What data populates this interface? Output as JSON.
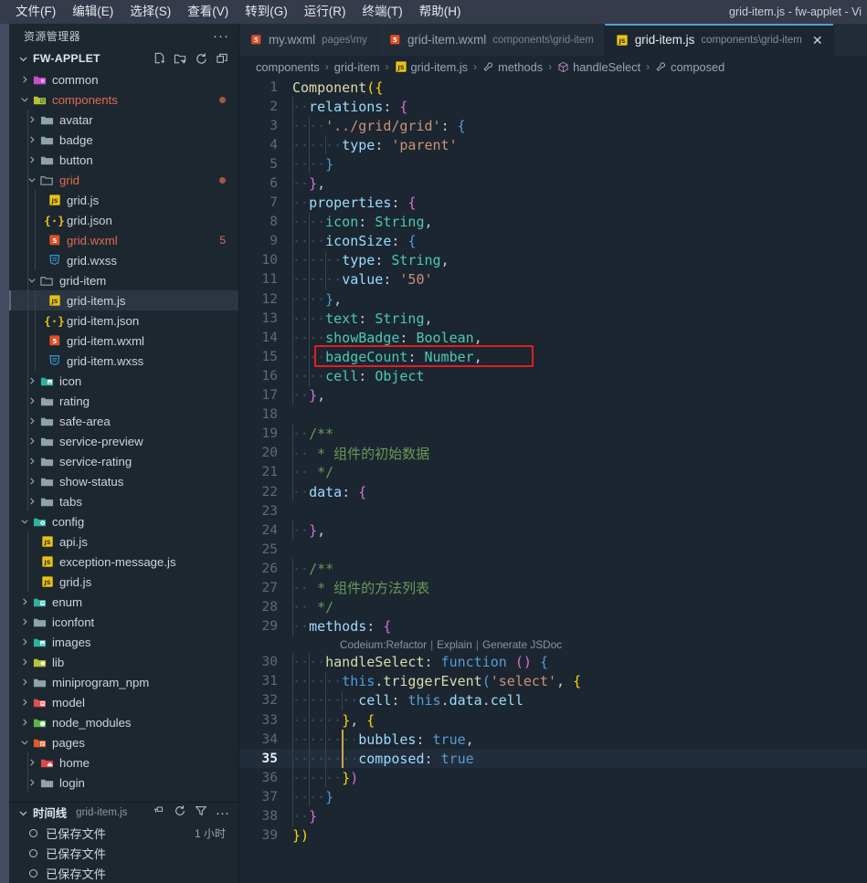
{
  "window": {
    "title": "grid-item.js - fw-applet - Vi",
    "menu": [
      "文件(F)",
      "编辑(E)",
      "选择(S)",
      "查看(V)",
      "转到(G)",
      "运行(R)",
      "终端(T)",
      "帮助(H)"
    ]
  },
  "sidebar": {
    "header_title": "资源管理器",
    "header_more": "···",
    "root": {
      "label": "FW-APPLET",
      "actions": [
        "new-file-icon",
        "new-folder-icon",
        "refresh-icon",
        "collapse-all-icon"
      ]
    },
    "tree": [
      {
        "label": "common",
        "depth": 1,
        "type": "folder",
        "icon": "folder-purple",
        "expanded": false
      },
      {
        "label": "components",
        "depth": 1,
        "type": "folder",
        "icon": "folder-lime",
        "expanded": true,
        "modified": true,
        "dot": true
      },
      {
        "label": "avatar",
        "depth": 2,
        "type": "folder",
        "icon": "folder-gray",
        "expanded": false
      },
      {
        "label": "badge",
        "depth": 2,
        "type": "folder",
        "icon": "folder-gray",
        "expanded": false
      },
      {
        "label": "button",
        "depth": 2,
        "type": "folder",
        "icon": "folder-gray",
        "expanded": false
      },
      {
        "label": "grid",
        "depth": 2,
        "type": "folder",
        "icon": "folder-open-gray",
        "expanded": true,
        "modified": true,
        "dot": true
      },
      {
        "label": "grid.js",
        "depth": 3,
        "type": "file",
        "icon": "js-icon"
      },
      {
        "label": "grid.json",
        "depth": 3,
        "type": "file",
        "icon": "json-icon"
      },
      {
        "label": "grid.wxml",
        "depth": 3,
        "type": "file",
        "icon": "html-icon",
        "modified": true,
        "badge": "5"
      },
      {
        "label": "grid.wxss",
        "depth": 3,
        "type": "file",
        "icon": "css-icon"
      },
      {
        "label": "grid-item",
        "depth": 2,
        "type": "folder",
        "icon": "folder-open-gray",
        "expanded": true
      },
      {
        "label": "grid-item.js",
        "depth": 3,
        "type": "file",
        "icon": "js-icon",
        "selected": true
      },
      {
        "label": "grid-item.json",
        "depth": 3,
        "type": "file",
        "icon": "json-icon"
      },
      {
        "label": "grid-item.wxml",
        "depth": 3,
        "type": "file",
        "icon": "html-icon"
      },
      {
        "label": "grid-item.wxss",
        "depth": 3,
        "type": "file",
        "icon": "css-icon"
      },
      {
        "label": "icon",
        "depth": 2,
        "type": "folder",
        "icon": "folder-teal-img",
        "expanded": false
      },
      {
        "label": "rating",
        "depth": 2,
        "type": "folder",
        "icon": "folder-gray",
        "expanded": false
      },
      {
        "label": "safe-area",
        "depth": 2,
        "type": "folder",
        "icon": "folder-gray",
        "expanded": false
      },
      {
        "label": "service-preview",
        "depth": 2,
        "type": "folder",
        "icon": "folder-gray",
        "expanded": false
      },
      {
        "label": "service-rating",
        "depth": 2,
        "type": "folder",
        "icon": "folder-gray",
        "expanded": false
      },
      {
        "label": "show-status",
        "depth": 2,
        "type": "folder",
        "icon": "folder-gray",
        "expanded": false
      },
      {
        "label": "tabs",
        "depth": 2,
        "type": "folder",
        "icon": "folder-gray",
        "expanded": false
      },
      {
        "label": "config",
        "depth": 1,
        "type": "folder",
        "icon": "folder-teal-gear",
        "expanded": true
      },
      {
        "label": "api.js",
        "depth": 2,
        "type": "file",
        "icon": "js-icon"
      },
      {
        "label": "exception-message.js",
        "depth": 2,
        "type": "file",
        "icon": "js-icon"
      },
      {
        "label": "grid.js",
        "depth": 2,
        "type": "file",
        "icon": "js-icon"
      },
      {
        "label": "enum",
        "depth": 1,
        "type": "folder",
        "icon": "folder-teal-list",
        "expanded": false
      },
      {
        "label": "iconfont",
        "depth": 1,
        "type": "folder",
        "icon": "folder-gray",
        "expanded": false
      },
      {
        "label": "images",
        "depth": 1,
        "type": "folder",
        "icon": "folder-teal-img",
        "expanded": false
      },
      {
        "label": "lib",
        "depth": 1,
        "type": "folder",
        "icon": "folder-lime-lib",
        "expanded": false
      },
      {
        "label": "miniprogram_npm",
        "depth": 1,
        "type": "folder",
        "icon": "folder-gray",
        "expanded": false
      },
      {
        "label": "model",
        "depth": 1,
        "type": "folder",
        "icon": "folder-red-list",
        "expanded": false
      },
      {
        "label": "node_modules",
        "depth": 1,
        "type": "folder",
        "icon": "folder-green-node",
        "expanded": false
      },
      {
        "label": "pages",
        "depth": 1,
        "type": "folder",
        "icon": "folder-orange-pages",
        "expanded": true
      },
      {
        "label": "home",
        "depth": 2,
        "type": "folder",
        "icon": "folder-red-home",
        "expanded": false
      },
      {
        "label": "login",
        "depth": 2,
        "type": "folder",
        "icon": "folder-gray",
        "expanded": false
      }
    ],
    "timeline": {
      "title": "时间线",
      "subtitle": "grid-item.js",
      "actions": [
        "pin-icon",
        "refresh-icon",
        "filter-icon",
        "more-icon"
      ],
      "entries": [
        {
          "label": "已保存文件",
          "when": "1 小时"
        },
        {
          "label": "已保存文件",
          "when": ""
        },
        {
          "label": "已保存文件",
          "when": ""
        }
      ]
    }
  },
  "tabs": [
    {
      "name": "my.wxml",
      "path": "pages\\my",
      "icon": "wxml-icon",
      "active": false,
      "closable": false
    },
    {
      "name": "grid-item.wxml",
      "path": "components\\grid-item",
      "icon": "wxml-icon",
      "active": false,
      "closable": false
    },
    {
      "name": "grid-item.js",
      "path": "components\\grid-item",
      "icon": "js-icon",
      "active": true,
      "closable": true,
      "close": "✕"
    }
  ],
  "breadcrumb": [
    {
      "label": "components",
      "icon": ""
    },
    {
      "label": "grid-item",
      "icon": ""
    },
    {
      "label": "grid-item.js",
      "icon": "js-icon"
    },
    {
      "label": "methods",
      "icon": "wrench-icon"
    },
    {
      "label": "handleSelect",
      "icon": "cube-icon"
    },
    {
      "label": "composed",
      "icon": "wrench-icon"
    }
  ],
  "editor": {
    "current_line": 35,
    "codelens": {
      "prefix": "Codeium:",
      "items": [
        "Refactor",
        "Explain",
        "Generate JSDoc"
      ],
      "after_line": 29
    },
    "annotation": {
      "line": 15,
      "color": "#e02020"
    },
    "lines": [
      {
        "n": 1,
        "tokens": [
          {
            "t": "Component",
            "c": "t-fn"
          },
          {
            "t": "(",
            "c": "t-b1"
          },
          {
            "t": "{",
            "c": "t-b1"
          }
        ]
      },
      {
        "n": 2,
        "indent": 1,
        "tokens": [
          {
            "t": "relations",
            "c": "t-prop"
          },
          {
            "t": ": ",
            "c": "t-plain"
          },
          {
            "t": "{",
            "c": "t-b2"
          }
        ]
      },
      {
        "n": 3,
        "indent": 2,
        "tokens": [
          {
            "t": "'../grid/grid'",
            "c": "t-str"
          },
          {
            "t": ": ",
            "c": "t-plain"
          },
          {
            "t": "{",
            "c": "t-b3"
          }
        ]
      },
      {
        "n": 4,
        "indent": 3,
        "tokens": [
          {
            "t": "type",
            "c": "t-prop"
          },
          {
            "t": ": ",
            "c": "t-plain"
          },
          {
            "t": "'parent'",
            "c": "t-str"
          }
        ]
      },
      {
        "n": 5,
        "indent": 2,
        "tokens": [
          {
            "t": "}",
            "c": "t-b3"
          }
        ]
      },
      {
        "n": 6,
        "indent": 1,
        "tokens": [
          {
            "t": "}",
            "c": "t-b2"
          },
          {
            "t": ",",
            "c": "t-plain"
          }
        ]
      },
      {
        "n": 7,
        "indent": 1,
        "tokens": [
          {
            "t": "properties",
            "c": "t-prop"
          },
          {
            "t": ": ",
            "c": "t-plain"
          },
          {
            "t": "{",
            "c": "t-b2"
          }
        ]
      },
      {
        "n": 8,
        "indent": 2,
        "tokens": [
          {
            "t": "icon",
            "c": "t-type"
          },
          {
            "t": ": ",
            "c": "t-plain"
          },
          {
            "t": "String",
            "c": "t-type"
          },
          {
            "t": ",",
            "c": "t-plain"
          }
        ]
      },
      {
        "n": 9,
        "indent": 2,
        "tokens": [
          {
            "t": "iconSize",
            "c": "t-prop"
          },
          {
            "t": ": ",
            "c": "t-plain"
          },
          {
            "t": "{",
            "c": "t-b3"
          }
        ]
      },
      {
        "n": 10,
        "indent": 3,
        "tokens": [
          {
            "t": "type",
            "c": "t-prop"
          },
          {
            "t": ": ",
            "c": "t-plain"
          },
          {
            "t": "String",
            "c": "t-type"
          },
          {
            "t": ",",
            "c": "t-plain"
          }
        ]
      },
      {
        "n": 11,
        "indent": 3,
        "tokens": [
          {
            "t": "value",
            "c": "t-prop"
          },
          {
            "t": ": ",
            "c": "t-plain"
          },
          {
            "t": "'50'",
            "c": "t-str"
          }
        ]
      },
      {
        "n": 12,
        "indent": 2,
        "tokens": [
          {
            "t": "}",
            "c": "t-b3"
          },
          {
            "t": ",",
            "c": "t-plain"
          }
        ]
      },
      {
        "n": 13,
        "indent": 2,
        "tokens": [
          {
            "t": "text",
            "c": "t-type"
          },
          {
            "t": ": ",
            "c": "t-plain"
          },
          {
            "t": "String",
            "c": "t-type"
          },
          {
            "t": ",",
            "c": "t-plain"
          }
        ]
      },
      {
        "n": 14,
        "indent": 2,
        "tokens": [
          {
            "t": "showBadge",
            "c": "t-type"
          },
          {
            "t": ": ",
            "c": "t-plain"
          },
          {
            "t": "Boolean",
            "c": "t-type"
          },
          {
            "t": ",",
            "c": "t-plain"
          }
        ]
      },
      {
        "n": 15,
        "indent": 2,
        "tokens": [
          {
            "t": "badgeCount",
            "c": "t-type"
          },
          {
            "t": ": ",
            "c": "t-plain"
          },
          {
            "t": "Number",
            "c": "t-type"
          },
          {
            "t": ",",
            "c": "t-plain"
          }
        ]
      },
      {
        "n": 16,
        "indent": 2,
        "tokens": [
          {
            "t": "cell",
            "c": "t-type"
          },
          {
            "t": ": ",
            "c": "t-plain"
          },
          {
            "t": "Object",
            "c": "t-type"
          }
        ]
      },
      {
        "n": 17,
        "indent": 1,
        "tokens": [
          {
            "t": "}",
            "c": "t-b2"
          },
          {
            "t": ",",
            "c": "t-plain"
          }
        ]
      },
      {
        "n": 18,
        "indent": 0,
        "tokens": []
      },
      {
        "n": 19,
        "indent": 1,
        "tokens": [
          {
            "t": "/**",
            "c": "t-com"
          }
        ]
      },
      {
        "n": 20,
        "indent": 1,
        "extra": " ",
        "tokens": [
          {
            "t": "* 组件的初始数据",
            "c": "t-com"
          }
        ]
      },
      {
        "n": 21,
        "indent": 1,
        "extra": " ",
        "tokens": [
          {
            "t": "*/",
            "c": "t-com"
          }
        ]
      },
      {
        "n": 22,
        "indent": 1,
        "tokens": [
          {
            "t": "data",
            "c": "t-prop"
          },
          {
            "t": ": ",
            "c": "t-plain"
          },
          {
            "t": "{",
            "c": "t-b2"
          }
        ]
      },
      {
        "n": 23,
        "indent": 0,
        "tokens": []
      },
      {
        "n": 24,
        "indent": 1,
        "tokens": [
          {
            "t": "}",
            "c": "t-b2"
          },
          {
            "t": ",",
            "c": "t-plain"
          }
        ]
      },
      {
        "n": 25,
        "indent": 0,
        "tokens": []
      },
      {
        "n": 26,
        "indent": 1,
        "tokens": [
          {
            "t": "/**",
            "c": "t-com"
          }
        ]
      },
      {
        "n": 27,
        "indent": 1,
        "extra": " ",
        "tokens": [
          {
            "t": "* 组件的方法列表",
            "c": "t-com"
          }
        ]
      },
      {
        "n": 28,
        "indent": 1,
        "extra": " ",
        "tokens": [
          {
            "t": "*/",
            "c": "t-com"
          }
        ]
      },
      {
        "n": 29,
        "indent": 1,
        "tokens": [
          {
            "t": "methods",
            "c": "t-prop"
          },
          {
            "t": ": ",
            "c": "t-plain"
          },
          {
            "t": "{",
            "c": "t-b2"
          }
        ]
      },
      {
        "n": 30,
        "indent": 2,
        "tokens": [
          {
            "t": "handleSelect",
            "c": "t-meth"
          },
          {
            "t": ": ",
            "c": "t-plain"
          },
          {
            "t": "function",
            "c": "t-this"
          },
          {
            "t": " ",
            "c": "t-plain"
          },
          {
            "t": "()",
            "c": "t-b2"
          },
          {
            "t": " ",
            "c": "t-plain"
          },
          {
            "t": "{",
            "c": "t-b3"
          }
        ]
      },
      {
        "n": 31,
        "indent": 3,
        "tokens": [
          {
            "t": "this",
            "c": "t-this"
          },
          {
            "t": ".",
            "c": "t-plain"
          },
          {
            "t": "triggerEvent",
            "c": "t-meth"
          },
          {
            "t": "(",
            "c": "t-b3"
          },
          {
            "t": "'select'",
            "c": "t-str"
          },
          {
            "t": ", ",
            "c": "t-plain"
          },
          {
            "t": "{",
            "c": "t-b1"
          }
        ]
      },
      {
        "n": 32,
        "indent": 4,
        "tokens": [
          {
            "t": "cell",
            "c": "t-prop"
          },
          {
            "t": ": ",
            "c": "t-plain"
          },
          {
            "t": "this",
            "c": "t-this"
          },
          {
            "t": ".",
            "c": "t-plain"
          },
          {
            "t": "data",
            "c": "t-prop"
          },
          {
            "t": ".",
            "c": "t-plain"
          },
          {
            "t": "cell",
            "c": "t-prop"
          }
        ]
      },
      {
        "n": 33,
        "indent": 3,
        "tokens": [
          {
            "t": "}",
            "c": "t-b1"
          },
          {
            "t": ", ",
            "c": "t-plain"
          },
          {
            "t": "{",
            "c": "t-b1"
          }
        ]
      },
      {
        "n": 34,
        "indent": 4,
        "tokens": [
          {
            "t": "bubbles",
            "c": "t-prop"
          },
          {
            "t": ": ",
            "c": "t-plain"
          },
          {
            "t": "true",
            "c": "t-bool"
          },
          {
            "t": ",",
            "c": "t-plain"
          }
        ]
      },
      {
        "n": 35,
        "indent": 4,
        "tokens": [
          {
            "t": "composed",
            "c": "t-prop"
          },
          {
            "t": ": ",
            "c": "t-plain"
          },
          {
            "t": "true",
            "c": "t-bool"
          }
        ]
      },
      {
        "n": 36,
        "indent": 3,
        "tokens": [
          {
            "t": "}",
            "c": "t-b1"
          },
          {
            "t": ")",
            "c": "t-b2"
          }
        ]
      },
      {
        "n": 37,
        "indent": 2,
        "tokens": [
          {
            "t": "}",
            "c": "t-b3"
          }
        ]
      },
      {
        "n": 38,
        "indent": 1,
        "tokens": [
          {
            "t": "}",
            "c": "t-b2"
          }
        ]
      },
      {
        "n": 39,
        "indent": 0,
        "tokens": [
          {
            "t": "}",
            "c": "t-b1"
          },
          {
            "t": ")",
            "c": "t-b1"
          }
        ]
      }
    ]
  }
}
